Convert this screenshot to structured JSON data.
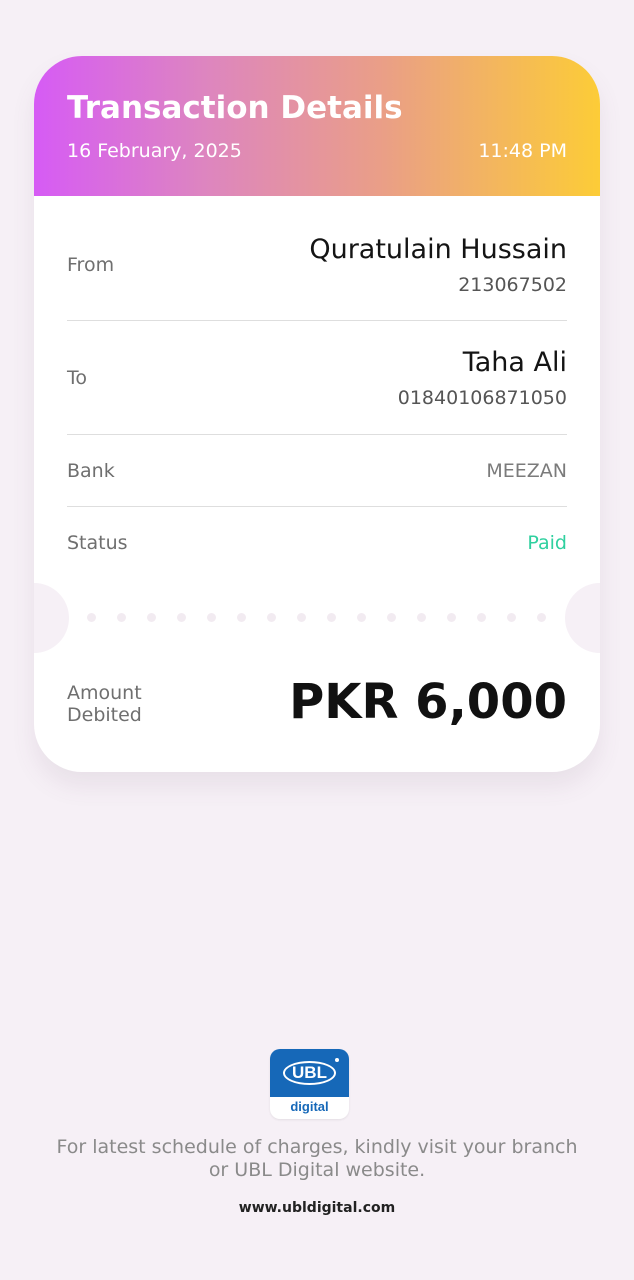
{
  "header": {
    "title": "Transaction Details",
    "date": "16 February, 2025",
    "time": "11:48 PM"
  },
  "details": {
    "from": {
      "label": "From",
      "name": "Quratulain Hussain",
      "account": "213067502"
    },
    "to": {
      "label": "To",
      "name": "Taha Ali",
      "account": "01840106871050"
    },
    "bank": {
      "label": "Bank",
      "value": "MEEZAN"
    },
    "status": {
      "label": "Status",
      "value": "Paid",
      "color": "#2fd09f"
    }
  },
  "amount": {
    "label_line1": "Amount",
    "label_line2": "Debited",
    "value": "PKR 6,000"
  },
  "logo": {
    "mark": "UBL",
    "subtitle": "digital",
    "color": "#1668b8"
  },
  "footer": {
    "note_line1": "For latest schedule of charges, kindly visit your branch",
    "note_line2": "or UBL Digital website.",
    "link": "www.ubldigital.com"
  },
  "colors": {
    "background": "#f6f0f6",
    "header_gradient_start": "#d65bf5",
    "header_gradient_end": "#fccc37"
  }
}
